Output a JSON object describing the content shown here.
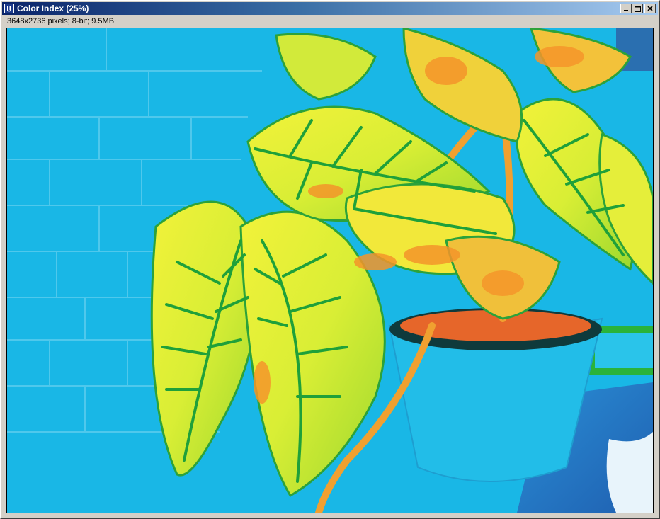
{
  "window": {
    "title": "Color Index (25%)",
    "icon": "imagej-icon"
  },
  "image_info": "3648x2736 pixels; 8-bit; 9.5MB",
  "controls": {
    "minimize": "minimize-icon",
    "maximize": "maximize-icon",
    "close": "close-icon"
  },
  "colors": {
    "background": "#19b7e6",
    "leaf_yellow": "#e9f03a",
    "leaf_green": "#22a836",
    "leaf_orange": "#f4a22a"
  }
}
